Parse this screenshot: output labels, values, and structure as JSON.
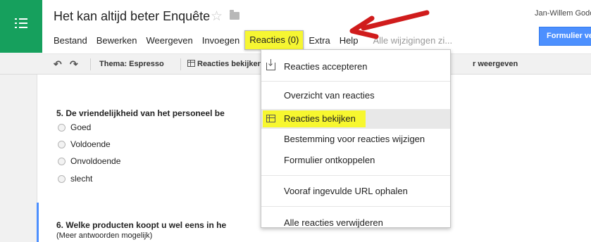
{
  "header": {
    "doc_title": "Het kan altijd beter Enquête",
    "user_name": "Jan-Willem Godo",
    "submit_label": "Formulier verzende"
  },
  "menubar": {
    "items": [
      "Bestand",
      "Bewerken",
      "Weergeven",
      "Invoegen",
      "Reacties (0)",
      "Extra",
      "Help"
    ],
    "save_status": "Alle wijzigingen zi..."
  },
  "toolbar": {
    "theme_label": "Thema: Espresso",
    "responses_label": "Reacties bekijken",
    "view_label": "r weergeven"
  },
  "form": {
    "q5": "5. De vriendelijkheid van het personeel be",
    "q5_options": [
      "Goed",
      "Voldoende",
      "Onvoldoende",
      "slecht"
    ],
    "q6": "6. Welke producten koopt u wel eens in he",
    "q6_help": "(Meer antwoorden mogelijk)"
  },
  "dropdown": {
    "items": [
      "Reacties accepteren",
      "Overzicht van reacties",
      "Reacties bekijken",
      "Bestemming voor reacties wijzigen",
      "Formulier ontkoppelen",
      "Vooraf ingevulde URL ophalen",
      "Alle reacties verwijderen"
    ]
  },
  "colors": {
    "app_green": "#16a05d",
    "highlight_yellow": "#f7f72f",
    "submit_blue": "#4d90fe",
    "annotation_red": "#d01c1c"
  },
  "icons": [
    "app-icon",
    "star-icon",
    "folder-icon",
    "undo-icon",
    "redo-icon",
    "grid-icon",
    "accept-icon",
    "arrow-annotation"
  ]
}
